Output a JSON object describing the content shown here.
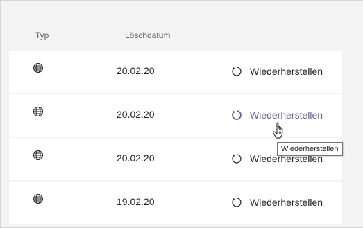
{
  "header": {
    "type_label": "Typ",
    "date_label": "Löschdatum"
  },
  "rows": [
    {
      "icon": "globe-icon",
      "date": "20.02.20",
      "action": "Wiederherstellen",
      "hovered": false
    },
    {
      "icon": "globe-icon",
      "date": "20.02.20",
      "action": "Wiederherstellen",
      "hovered": true
    },
    {
      "icon": "globe-icon",
      "date": "20.02.20",
      "action": "Wiederherstellen",
      "hovered": false
    },
    {
      "icon": "globe-icon",
      "date": "19.02.20",
      "action": "Wiederherstellen",
      "hovered": false
    }
  ],
  "tooltip": {
    "text": "Wiederherstellen"
  },
  "colors": {
    "accent": "#6264a7",
    "text": "#252423",
    "muted": "#605e5c",
    "background": "#f3f3f3",
    "row_background": "#ffffff"
  }
}
